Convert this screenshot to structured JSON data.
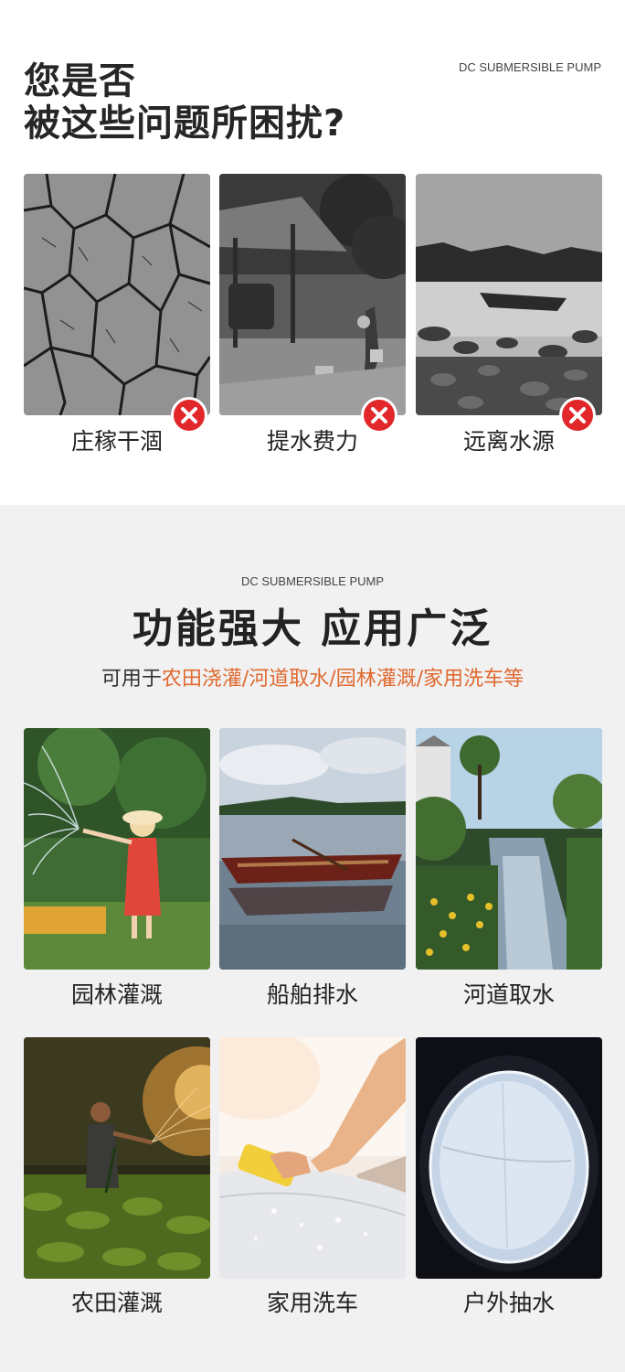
{
  "section1": {
    "title_line1": "您是否",
    "title_line2": "被这些问题所困扰?",
    "tag": "DC SUBMERSIBLE PUMP",
    "problems": [
      {
        "label": "庄稼干涸",
        "icon": "x-mark-icon"
      },
      {
        "label": "提水费力",
        "icon": "x-mark-icon"
      },
      {
        "label": "远离水源",
        "icon": "x-mark-icon"
      }
    ],
    "badge_color": "#e2272b"
  },
  "section2": {
    "tag": "DC SUBMERSIBLE PUMP",
    "title": "功能强大  应用广泛",
    "subtitle_prefix": "可用于",
    "subtitle_highlight": "农田浇灌/河道取水/园林灌溉/家用洗车等",
    "highlight_color": "#e0692f",
    "uses": [
      {
        "label": "园林灌溉"
      },
      {
        "label": "船舶排水"
      },
      {
        "label": "河道取水"
      },
      {
        "label": "农田灌溉"
      },
      {
        "label": "家用洗车"
      },
      {
        "label": "户外抽水"
      }
    ]
  }
}
